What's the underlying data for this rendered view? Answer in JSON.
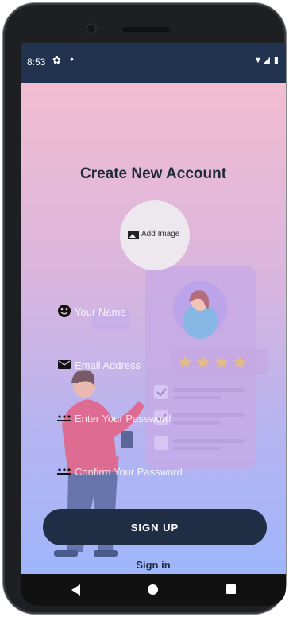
{
  "status": {
    "time": "8:53",
    "settings_icon": "gear-icon",
    "notification_icon": "dot-icon",
    "signal_icons": "▼◢ ▮"
  },
  "form": {
    "title": "Create New Account",
    "add_image_label": "Add Image",
    "name_placeholder": "Your Name",
    "email_placeholder": "Email Address",
    "password_placeholder": "Enter Your Password",
    "confirm_placeholder": "Confirm Your Password",
    "signup_label": "SIGN UP",
    "signin_label": "Sign in"
  },
  "colors": {
    "accent": "#1f2d45",
    "gradient_top": "#f2bdd0",
    "gradient_bottom": "#9fb6fb"
  }
}
